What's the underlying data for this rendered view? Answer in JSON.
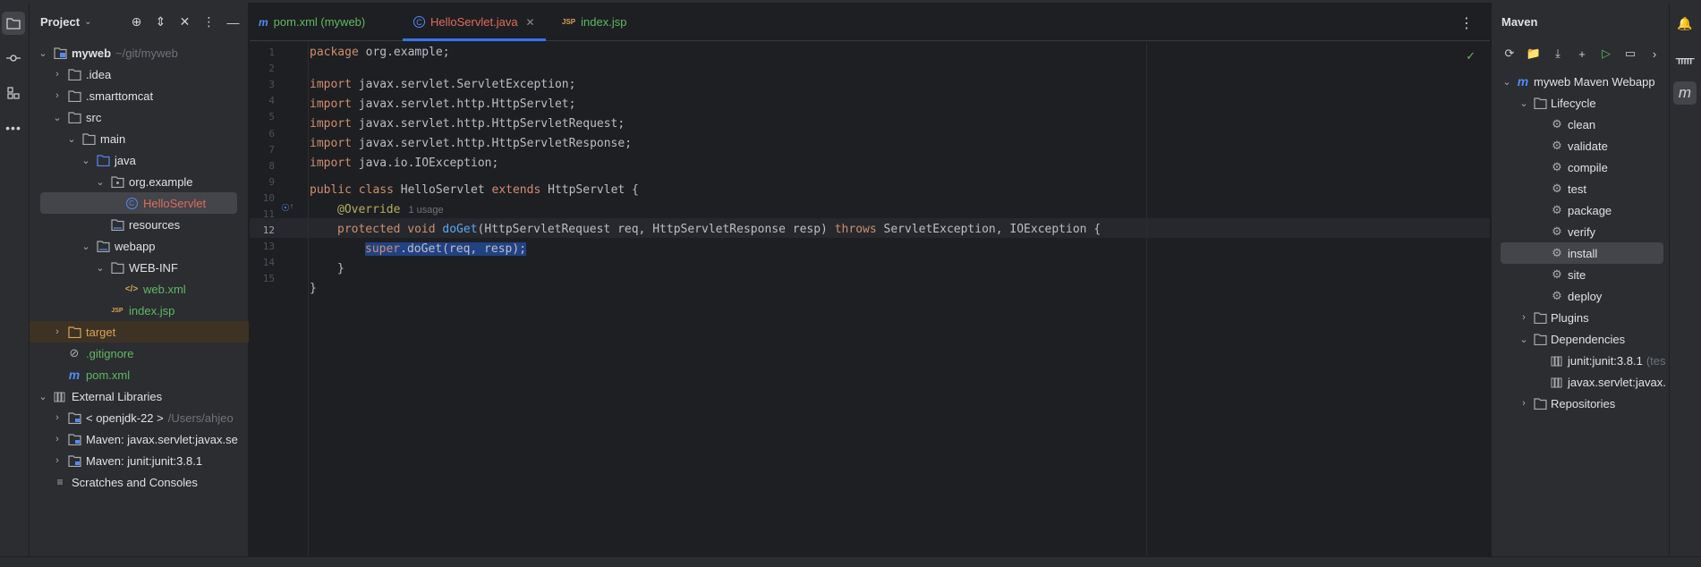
{
  "project_panel": {
    "title": "Project",
    "tree": [
      {
        "label": "myweb",
        "extra": "~/git/myweb",
        "depth": 0,
        "expanded": true,
        "icon": "module-folder-icon",
        "bold": true
      },
      {
        "label": ".idea",
        "depth": 1,
        "expanded": false,
        "icon": "folder-icon"
      },
      {
        "label": ".smarttomcat",
        "depth": 1,
        "expanded": false,
        "icon": "folder-icon"
      },
      {
        "label": "src",
        "depth": 1,
        "expanded": true,
        "icon": "folder-icon"
      },
      {
        "label": "main",
        "depth": 2,
        "expanded": true,
        "icon": "folder-icon"
      },
      {
        "label": "java",
        "depth": 3,
        "expanded": true,
        "icon": "source-folder-icon"
      },
      {
        "label": "org.example",
        "depth": 4,
        "expanded": true,
        "icon": "package-icon"
      },
      {
        "label": "HelloServlet",
        "depth": 5,
        "icon": "class-icon",
        "selected": true,
        "color": "#e06c5a"
      },
      {
        "label": "resources",
        "depth": 4,
        "icon": "resources-folder-icon"
      },
      {
        "label": "webapp",
        "depth": 3,
        "expanded": true,
        "icon": "web-folder-icon"
      },
      {
        "label": "WEB-INF",
        "depth": 4,
        "expanded": true,
        "icon": "folder-icon"
      },
      {
        "label": "web.xml",
        "depth": 5,
        "icon": "xml-file-icon",
        "color": "#5fb865"
      },
      {
        "label": "index.jsp",
        "depth": 4,
        "icon": "jsp-file-icon",
        "color": "#5fb865"
      },
      {
        "label": "target",
        "depth": 1,
        "expanded": false,
        "icon": "excluded-folder-icon",
        "color": "#d6a35a",
        "highlight": true
      },
      {
        "label": ".gitignore",
        "depth": 1,
        "icon": "ignored-file-icon",
        "color": "#5fb865"
      },
      {
        "label": "pom.xml",
        "depth": 1,
        "icon": "maven-file-icon",
        "color": "#5fb865"
      },
      {
        "label": "External Libraries",
        "depth": 0,
        "expanded": true,
        "icon": "library-icon"
      },
      {
        "label": "< openjdk-22 >",
        "extra": "/Users/ahjeo",
        "depth": 1,
        "expanded": false,
        "icon": "jdk-folder-icon"
      },
      {
        "label": "Maven: javax.servlet:javax.se",
        "depth": 1,
        "expanded": false,
        "icon": "library-folder-icon"
      },
      {
        "label": "Maven: junit:junit:3.8.1",
        "depth": 1,
        "expanded": false,
        "icon": "library-folder-icon"
      },
      {
        "label": "Scratches and Consoles",
        "depth": 0,
        "icon": "scratches-icon"
      }
    ]
  },
  "editor": {
    "tabs": [
      {
        "label": "pom.xml (myweb)",
        "icon": "m",
        "color": "#5fb865",
        "active": false
      },
      {
        "label": "HelloServlet.java",
        "icon": "C",
        "color": "#e06c5a",
        "active": true
      },
      {
        "label": "index.jsp",
        "icon": "JSP",
        "color": "#5fb865",
        "active": false
      }
    ],
    "line_numbers": [
      "1",
      "2",
      "3",
      "4",
      "5",
      "6",
      "7",
      "8",
      "9",
      "10",
      "11",
      "12",
      "13",
      "14",
      "15"
    ],
    "current_line": "12",
    "code": {
      "l1_kw": "package",
      "l1_rest": " org.example;",
      "l3_kw": "import",
      "l3_rest": " javax.servlet.ServletException;",
      "l4_kw": "import",
      "l4_rest": " javax.servlet.http.HttpServlet;",
      "l5_kw": "import",
      "l5_rest": " javax.servlet.http.HttpServletRequest;",
      "l6_kw": "import",
      "l6_rest": " javax.servlet.http.HttpServletResponse;",
      "l7_kw": "import",
      "l7_rest": " java.io.IOException;",
      "l9_kw1": "public class",
      "l9_name": " HelloServlet ",
      "l9_kw2": "extends",
      "l9_rest": " HttpServlet {",
      "l10_ann": "@Override",
      "l10_hint": "1 usage",
      "l11_kw1": "protected void",
      "l11_fn": "doGet",
      "l11_mid": "(HttpServletRequest req, HttpServletResponse resp) ",
      "l11_kw2": "throws",
      "l11_rest": " ServletException, IOException {",
      "l12_kw": "super",
      "l12_rest": ".doGet(req, resp);",
      "l13": "}",
      "l14": "}"
    }
  },
  "maven_panel": {
    "title": "Maven",
    "tree": [
      {
        "label": "myweb Maven Webapp",
        "depth": 0,
        "expanded": true,
        "icon": "maven-project-icon"
      },
      {
        "label": "Lifecycle",
        "depth": 1,
        "expanded": true,
        "icon": "lifecycle-folder-icon"
      },
      {
        "label": "clean",
        "depth": 2,
        "icon": "gear-icon"
      },
      {
        "label": "validate",
        "depth": 2,
        "icon": "gear-icon"
      },
      {
        "label": "compile",
        "depth": 2,
        "icon": "gear-icon"
      },
      {
        "label": "test",
        "depth": 2,
        "icon": "gear-icon"
      },
      {
        "label": "package",
        "depth": 2,
        "icon": "gear-icon"
      },
      {
        "label": "verify",
        "depth": 2,
        "icon": "gear-icon"
      },
      {
        "label": "install",
        "depth": 2,
        "icon": "gear-icon",
        "selected": true
      },
      {
        "label": "site",
        "depth": 2,
        "icon": "gear-icon"
      },
      {
        "label": "deploy",
        "depth": 2,
        "icon": "gear-icon"
      },
      {
        "label": "Plugins",
        "depth": 1,
        "expanded": false,
        "icon": "plugins-folder-icon"
      },
      {
        "label": "Dependencies",
        "depth": 1,
        "expanded": true,
        "icon": "dependencies-folder-icon"
      },
      {
        "label": "junit:junit:3.8.1",
        "extra": "(tes",
        "depth": 2,
        "icon": "library-icon"
      },
      {
        "label": "javax.servlet:javax.",
        "depth": 2,
        "icon": "library-icon"
      },
      {
        "label": "Repositories",
        "depth": 1,
        "expanded": false,
        "icon": "repositories-folder-icon"
      }
    ]
  }
}
